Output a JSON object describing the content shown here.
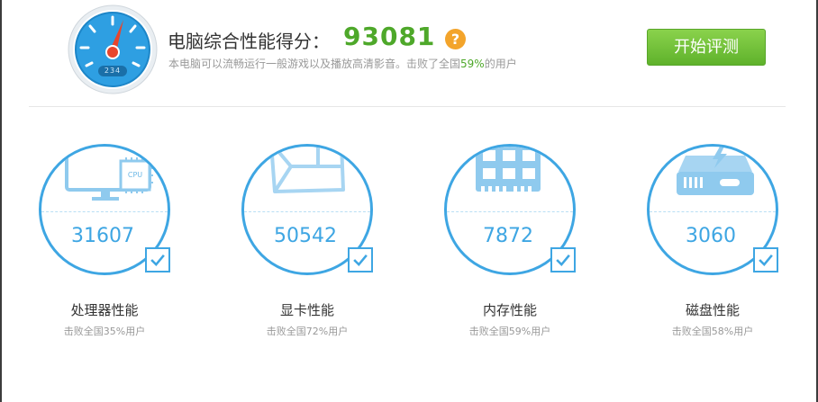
{
  "header": {
    "title": "电脑综合性能得分：",
    "score": "93081",
    "help_icon": "?",
    "summary_prefix": "本电脑可以流畅运行一般游戏以及播放高清影音。击败了全国",
    "summary_pct": "59%",
    "summary_suffix": "的用户",
    "gauge_readout": "234",
    "start_button": "开始评测"
  },
  "colors": {
    "accent": "#3ea6e3",
    "score_green": "#4ea82a",
    "help_orange": "#f3a42b"
  },
  "cards": [
    {
      "icon": "cpu-icon",
      "value": "31607",
      "label": "处理器性能",
      "sub": "击败全国35%用户",
      "chip_text": "CPU"
    },
    {
      "icon": "graphics-card-icon",
      "value": "50542",
      "label": "显卡性能",
      "sub": "击败全国72%用户"
    },
    {
      "icon": "memory-icon",
      "value": "7872",
      "label": "内存性能",
      "sub": "击败全国59%用户"
    },
    {
      "icon": "disk-icon",
      "value": "3060",
      "label": "磁盘性能",
      "sub": "击败全国58%用户"
    }
  ]
}
